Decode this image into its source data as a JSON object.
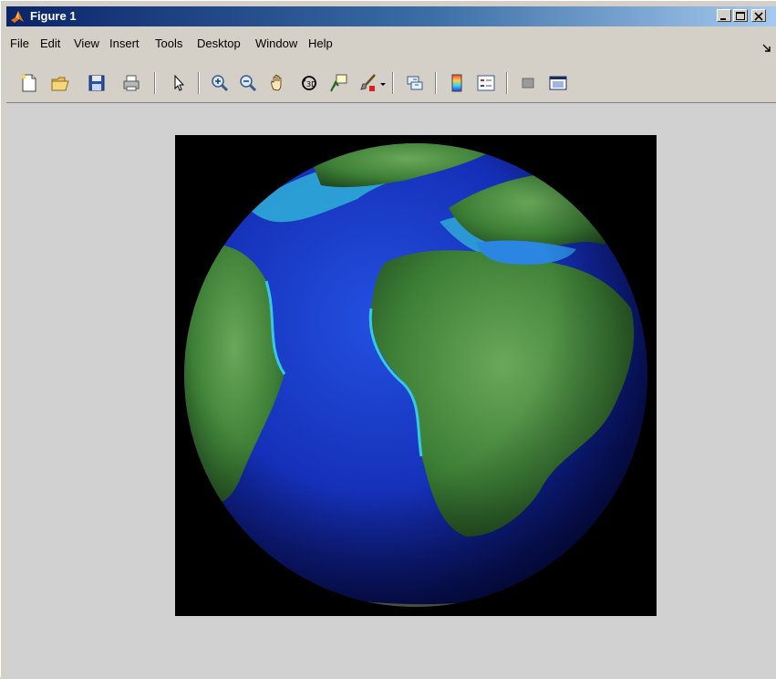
{
  "window": {
    "title": "Figure 1",
    "title_icon": "matlab-logo-icon",
    "controls": [
      "minimize-icon",
      "maximize-icon",
      "close-icon"
    ]
  },
  "menubar": {
    "items": [
      {
        "label": "File"
      },
      {
        "label": "Edit"
      },
      {
        "label": "View"
      },
      {
        "label": "Insert"
      },
      {
        "label": "Tools"
      },
      {
        "label": "Desktop"
      },
      {
        "label": "Window"
      },
      {
        "label": "Help"
      }
    ],
    "dock_icon": "dock-arrow-icon"
  },
  "toolbar": {
    "buttons": [
      {
        "icon": "new-figure-icon"
      },
      {
        "icon": "open-file-icon"
      },
      {
        "icon": "save-icon"
      },
      {
        "icon": "print-icon"
      },
      {
        "icon": "edit-plot-pointer-icon"
      },
      {
        "icon": "zoom-in-icon"
      },
      {
        "icon": "zoom-out-icon"
      },
      {
        "icon": "pan-hand-icon"
      },
      {
        "icon": "rotate-3d-icon"
      },
      {
        "icon": "data-cursor-icon"
      },
      {
        "icon": "brush-icon"
      },
      {
        "icon": "link-plot-icon"
      },
      {
        "icon": "insert-colorbar-icon"
      },
      {
        "icon": "insert-legend-icon"
      },
      {
        "icon": "hide-plot-tools-icon"
      },
      {
        "icon": "show-plot-tools-icon"
      }
    ]
  },
  "figure": {
    "content": "earth-globe-image",
    "axes_background": "#000000",
    "colors": {
      "ocean_deep": "#0d1f9e",
      "ocean_shallow": "#27b8d8",
      "land": "#3f8a3a",
      "figure_bg": "#d1d1d1"
    }
  }
}
